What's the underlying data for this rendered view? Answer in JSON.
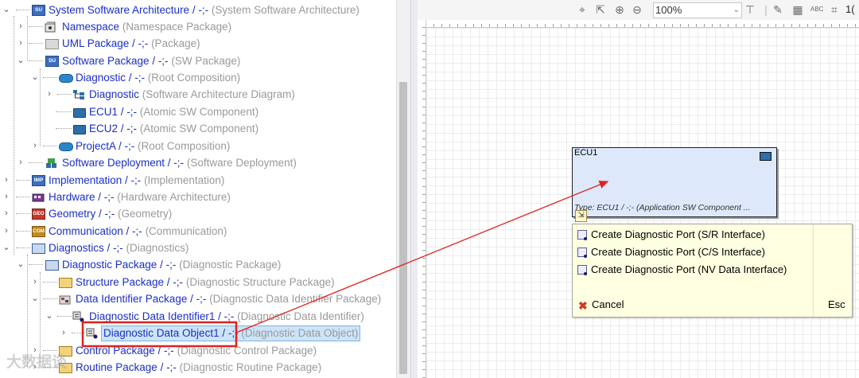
{
  "tree": {
    "items": [
      {
        "name": "System Software Architecture / -;-",
        "type": "(System Software Architecture)"
      },
      {
        "name": "Namespace",
        "type": "(Namespace Package)"
      },
      {
        "name": "UML Package / -;-",
        "type": "(Package)"
      },
      {
        "name": "Software Package / -;-",
        "type": "(SW Package)"
      },
      {
        "name": "Diagnostic / -;-",
        "type": "(Root Composition)"
      },
      {
        "name": "Diagnostic",
        "type": "(Software Architecture Diagram)"
      },
      {
        "name": "ECU1 / -;-",
        "type": "(Atomic SW Component)"
      },
      {
        "name": "ECU2 / -;-",
        "type": "(Atomic SW Component)"
      },
      {
        "name": "ProjectA / -;-",
        "type": "(Root Composition)"
      },
      {
        "name": "Software Deployment / -;-",
        "type": "(Software Deployment)"
      },
      {
        "name": "Implementation / -;-",
        "type": "(Implementation)"
      },
      {
        "name": "Hardware / -;-",
        "type": "(Hardware Architecture)"
      },
      {
        "name": "Geometry / -;-",
        "type": "(Geometry)"
      },
      {
        "name": "Communication / -;-",
        "type": "(Communication)"
      },
      {
        "name": "Diagnostics / -;-",
        "type": "(Diagnostics)"
      },
      {
        "name": "Diagnostic Package / -;-",
        "type": "(Diagnostic Package)"
      },
      {
        "name": "Structure Package / -;-",
        "type": "(Diagnostic Structure Package)"
      },
      {
        "name": "Data Identifier Package / -;-",
        "type": "(Diagnostic Data Identifier Package)"
      },
      {
        "name": "Diagnostic Data Identifier1 / -;-",
        "type": "(Diagnostic Data Identifier)"
      },
      {
        "name": "Diagnostic Data Object1 / -;-",
        "type": "(Diagnostic Data Object)"
      },
      {
        "name": "Control Package / -;-",
        "type": "(Diagnostic Control Package)"
      },
      {
        "name": "Routine Package / -;-",
        "type": "(Diagnostic Routine Package)"
      }
    ],
    "icon_tags": {
      "su": "SU",
      "impl": "IMP",
      "geo": "GEO",
      "com": "COM"
    }
  },
  "toolbar": {
    "zoom_value": "100%",
    "icons": [
      "fit-icon",
      "export-icon",
      "zoom-in-icon",
      "zoom-out-icon",
      "align-icon",
      "grid-icon",
      "pen-icon",
      "layout-icon",
      "spellcheck-icon",
      "frame-icon"
    ],
    "partial_label": "1("
  },
  "diagram": {
    "component_title": "ECU1",
    "component_type": "Type: ECU1 / -;- (Application SW Component ...",
    "component_fill": "#dde8fb"
  },
  "context_menu": {
    "items": [
      "Create Diagnostic Port (S/R Interface)",
      "Create Diagnostic Port (C/S Interface)",
      "Create Diagnostic Port (NV Data Interface)"
    ],
    "cancel": "Cancel",
    "shortcut": "Esc",
    "background": "#ffffe1"
  },
  "annotation": {
    "highlight_color": "#e02020",
    "arrow_color": "#e02020"
  },
  "watermark": "大数据谈"
}
